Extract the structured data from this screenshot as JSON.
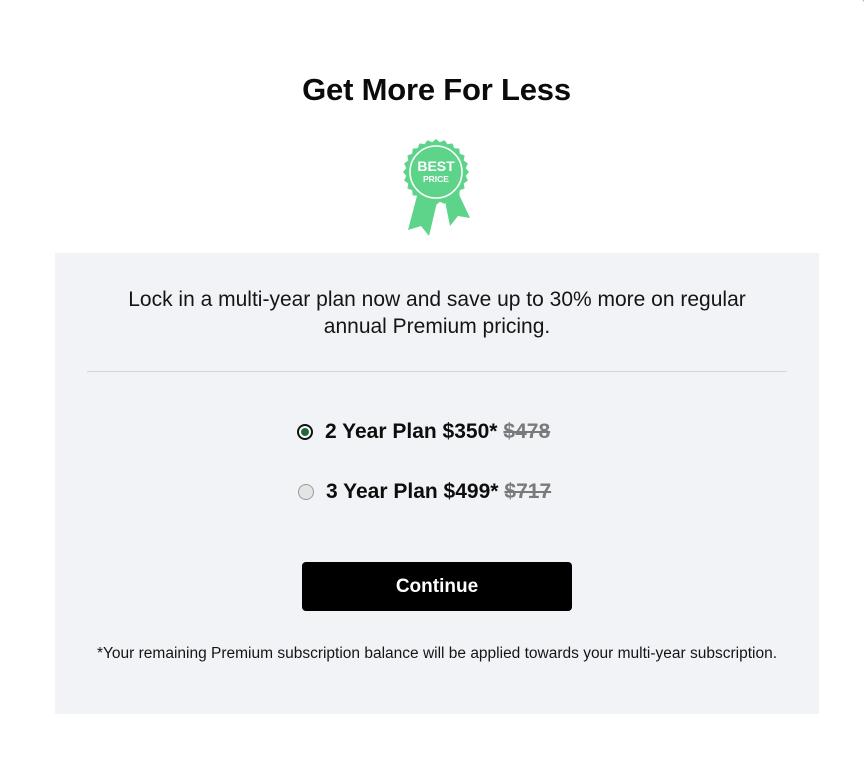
{
  "header": {
    "title": "Get More For Less",
    "corner_mark": "ˈ"
  },
  "badge": {
    "line1": "BEST",
    "line2": "PRICE",
    "color": "#5dd48a"
  },
  "panel": {
    "intro": "Lock in a multi-year plan now and save up to 30% more on regular annual Premium pricing.",
    "plans": [
      {
        "label": "2 Year Plan $350*",
        "original_price": "$478",
        "selected": true
      },
      {
        "label": "3 Year Plan $499*",
        "original_price": "$717",
        "selected": false
      }
    ],
    "continue_label": "Continue",
    "footnote": "*Your remaining Premium subscription balance will be applied towards your multi-year subscription."
  },
  "colors": {
    "panel_background": "#f2f3f6",
    "button_background": "#000000",
    "selected_radio": "#1e6b3a"
  }
}
